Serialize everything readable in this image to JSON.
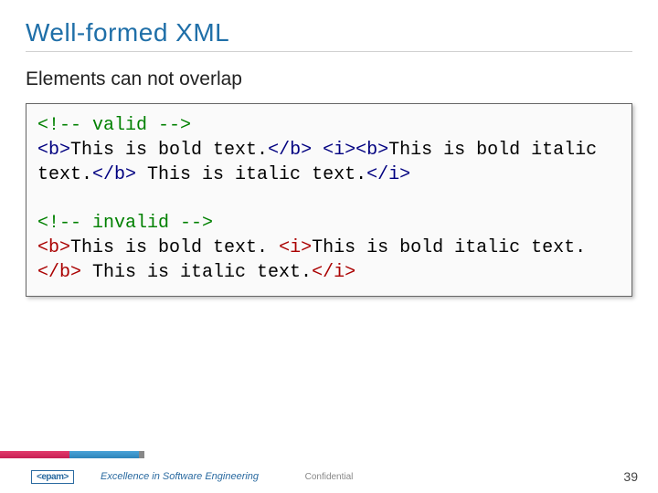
{
  "title": "Well-formed XML",
  "subtitle": "Elements can not overlap",
  "code": {
    "valid_comment_open": "<!-- ",
    "valid_comment_text": "valid",
    "valid_comment_close": " -->",
    "b_open": "<b>",
    "b_close": "</b>",
    "i_open": "<i>",
    "i_close": "</i>",
    "valid_text_1": "This is bold text.",
    "space": " ",
    "valid_text_2": "This is bold italic text.",
    "valid_text_3": " This is italic text.",
    "invalid_comment_open": "<!-- ",
    "invalid_comment_text": "invalid",
    "invalid_comment_close": " -->",
    "invalid_text_1": "This is bold text. ",
    "invalid_text_2": "This is bold italic text.",
    "invalid_text_3": " This is italic text."
  },
  "footer": {
    "logo": "<epam>",
    "tagline": "Excellence in Software Engineering",
    "confidential": "Confidential",
    "page": "39"
  }
}
